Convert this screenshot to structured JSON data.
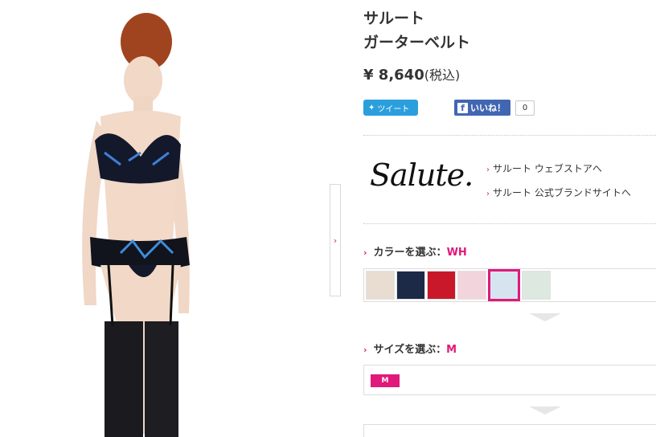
{
  "product": {
    "brand_name": "サルート",
    "item_name": "ガーターベルト",
    "price": "¥ 8,640",
    "tax_note": "(税込)"
  },
  "social": {
    "tweet_label": "ツイート",
    "like_label": "いいね！",
    "like_count": "0"
  },
  "brand": {
    "logo_text": "Salute.",
    "links": [
      "サルート ウェブストアへ",
      "サルート 公式ブランドサイトへ"
    ]
  },
  "color": {
    "label": "カラーを選ぶ：",
    "selected": "WH",
    "swatch_colors": [
      "#e9ddd2",
      "#1c2a48",
      "#c8182a",
      "#f2d5dc",
      "#d6e4f0",
      "#dce8e0"
    ]
  },
  "size": {
    "label": "サイズを選ぶ：",
    "selected": "M",
    "options": [
      "M"
    ]
  },
  "colors": {
    "accent": "#e0197a",
    "twitter": "#2b9fdd",
    "facebook": "#4267b2"
  }
}
